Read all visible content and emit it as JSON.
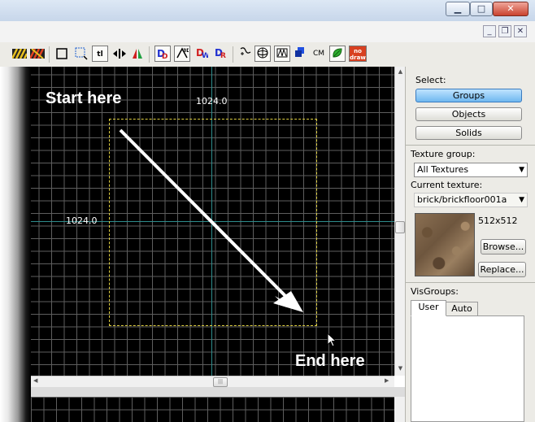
{
  "window_controls": {
    "minimize": "▁",
    "maximize": "□",
    "close": "✕"
  },
  "mdi_controls": {
    "minimize": "_",
    "restore": "❐",
    "close": "✕"
  },
  "toolbar": {
    "text_tool": "tl",
    "cm_label": "CM",
    "nodraw_label": "no draw"
  },
  "viewport": {
    "width_label": "1024.0",
    "height_label": "1024.0",
    "start_label": "Start here",
    "end_label": "End here",
    "scroll_arrow_up": "▲",
    "scroll_arrow_down": "▼",
    "scroll_arrow_left": "◀",
    "scroll_arrow_right": "▶",
    "scroll_grip": "|||"
  },
  "right_panel": {
    "select_label": "Select:",
    "groups_button": "Groups",
    "objects_button": "Objects",
    "solids_button": "Solids",
    "texture_group_label": "Texture group:",
    "texture_group_value": "All Textures",
    "current_texture_label": "Current texture:",
    "current_texture_value": "brick/brickfloor001a",
    "texture_size": "512x512",
    "browse_button": "Browse...",
    "replace_button": "Replace...",
    "visgroups_label": "VisGroups:",
    "tab_user": "User",
    "tab_auto": "Auto"
  },
  "colors": {
    "grid_background": "#000000",
    "grid_lines": "#5e5e5e",
    "axis_lines": "#2e8c8c",
    "selection_box": "#e0d040",
    "active_button": "#6fb8f0"
  }
}
